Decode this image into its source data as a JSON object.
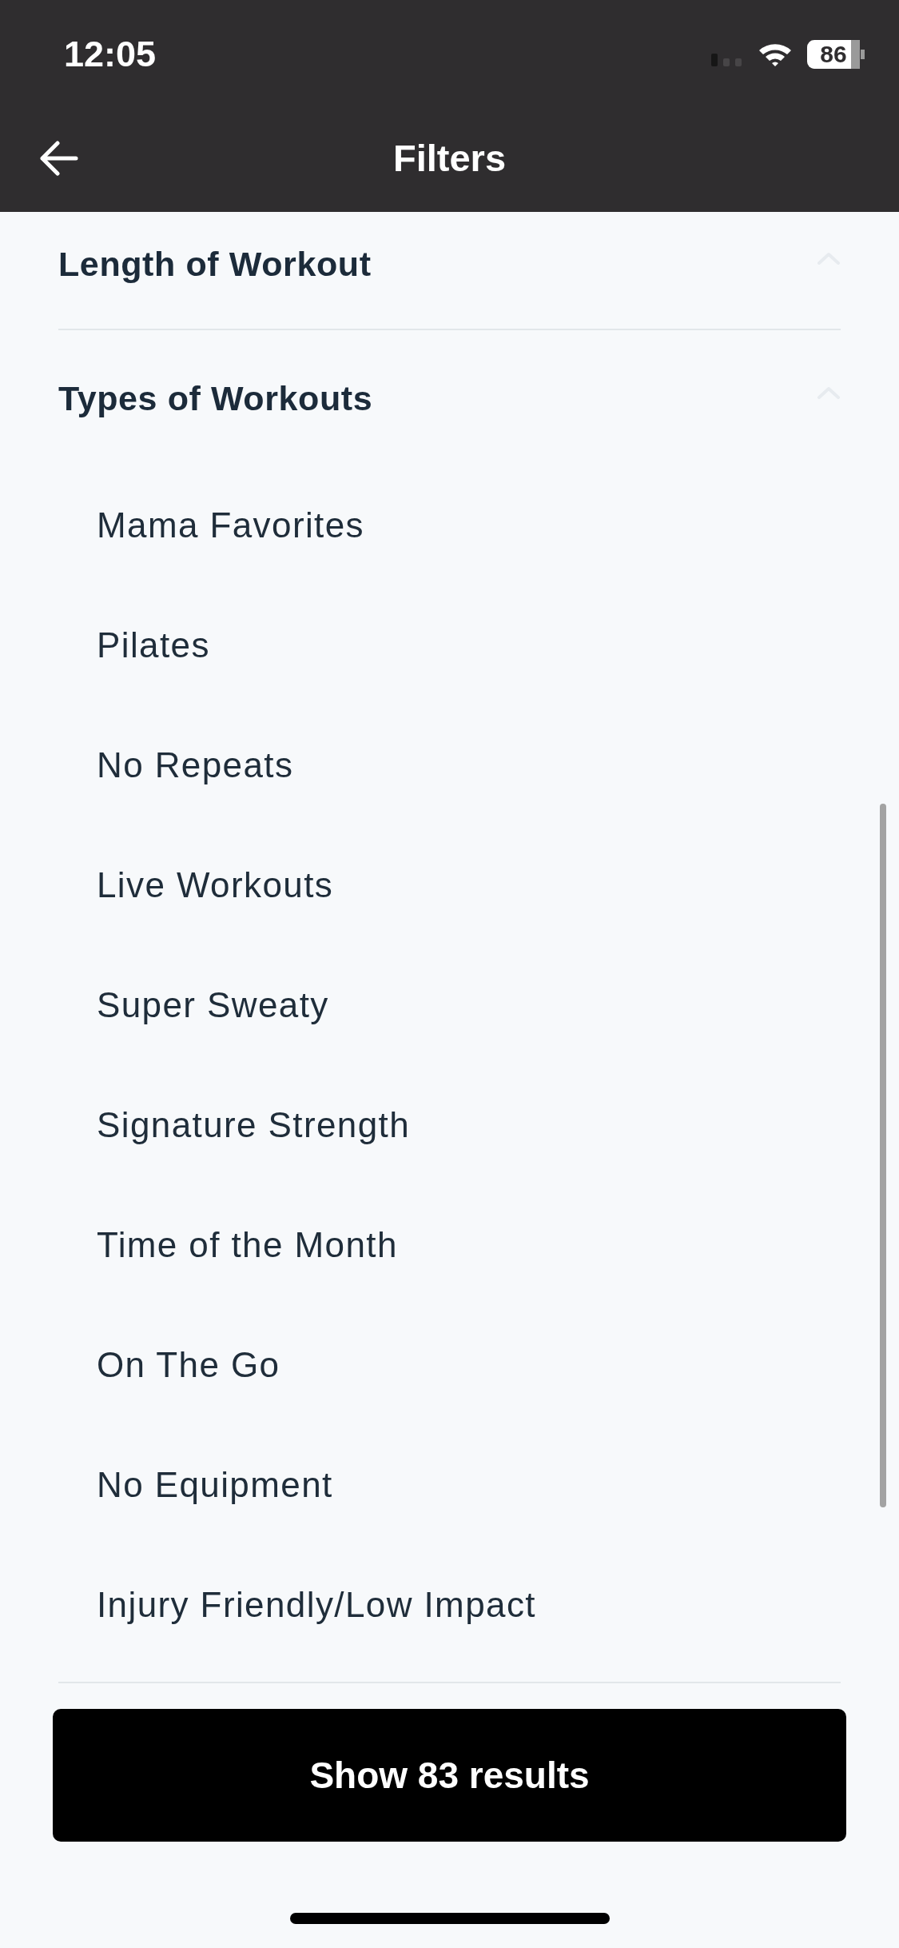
{
  "status_bar": {
    "time": "12:05",
    "battery": "86"
  },
  "nav": {
    "title": "Filters"
  },
  "sections": [
    {
      "title": "Length of Workout"
    },
    {
      "title": "Types of Workouts",
      "options": [
        "Mama Favorites",
        "Pilates",
        "No Repeats",
        "Live Workouts",
        "Super Sweaty",
        "Signature Strength",
        "Time of the Month",
        "On The Go",
        "No Equipment",
        "Injury Friendly/Low Impact"
      ]
    }
  ],
  "button": {
    "label": "Show 83 results"
  }
}
